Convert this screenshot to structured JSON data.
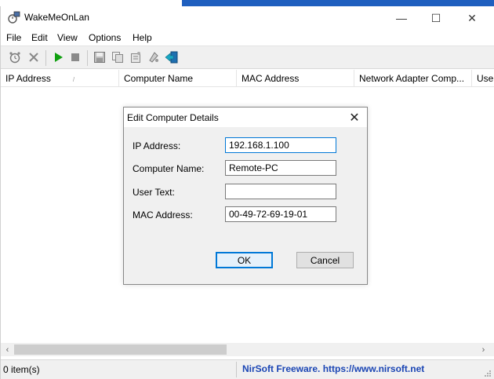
{
  "window": {
    "title": "WakeMeOnLan",
    "controls": {
      "minimize": "—",
      "maximize": "☐",
      "close": "✕"
    }
  },
  "menu": [
    "File",
    "Edit",
    "View",
    "Options",
    "Help"
  ],
  "toolbar": {
    "icons": [
      "alarm-clock-icon",
      "delete-icon",
      "start-icon",
      "stop-icon",
      "save-icon",
      "copy-icon",
      "properties-icon",
      "refresh-icon",
      "exit-icon"
    ]
  },
  "list": {
    "columns": [
      "IP Address",
      "Computer Name",
      "MAC Address",
      "Network Adapter Comp...",
      "Use"
    ],
    "sort_indicator": "/"
  },
  "scroll": {
    "left_arrow": "‹",
    "right_arrow": "›"
  },
  "status": {
    "items": "0 item(s)",
    "link": "NirSoft Freeware. https://www.nirsoft.net"
  },
  "dialog": {
    "title": "Edit Computer Details",
    "close_glyph": "✕",
    "fields": [
      {
        "label": "IP Address:",
        "value": "192.168.1.100"
      },
      {
        "label": "Computer Name:",
        "value": "Remote-PC"
      },
      {
        "label": "User Text:",
        "value": ""
      },
      {
        "label": "MAC Address:",
        "value": "00-49-72-69-19-01"
      }
    ],
    "ok_label": "OK",
    "cancel_label": "Cancel"
  },
  "colors": {
    "accent": "#0078d7",
    "link": "#1a45b4",
    "play_green": "#10a010",
    "title_strip": "#1f5fbf"
  }
}
